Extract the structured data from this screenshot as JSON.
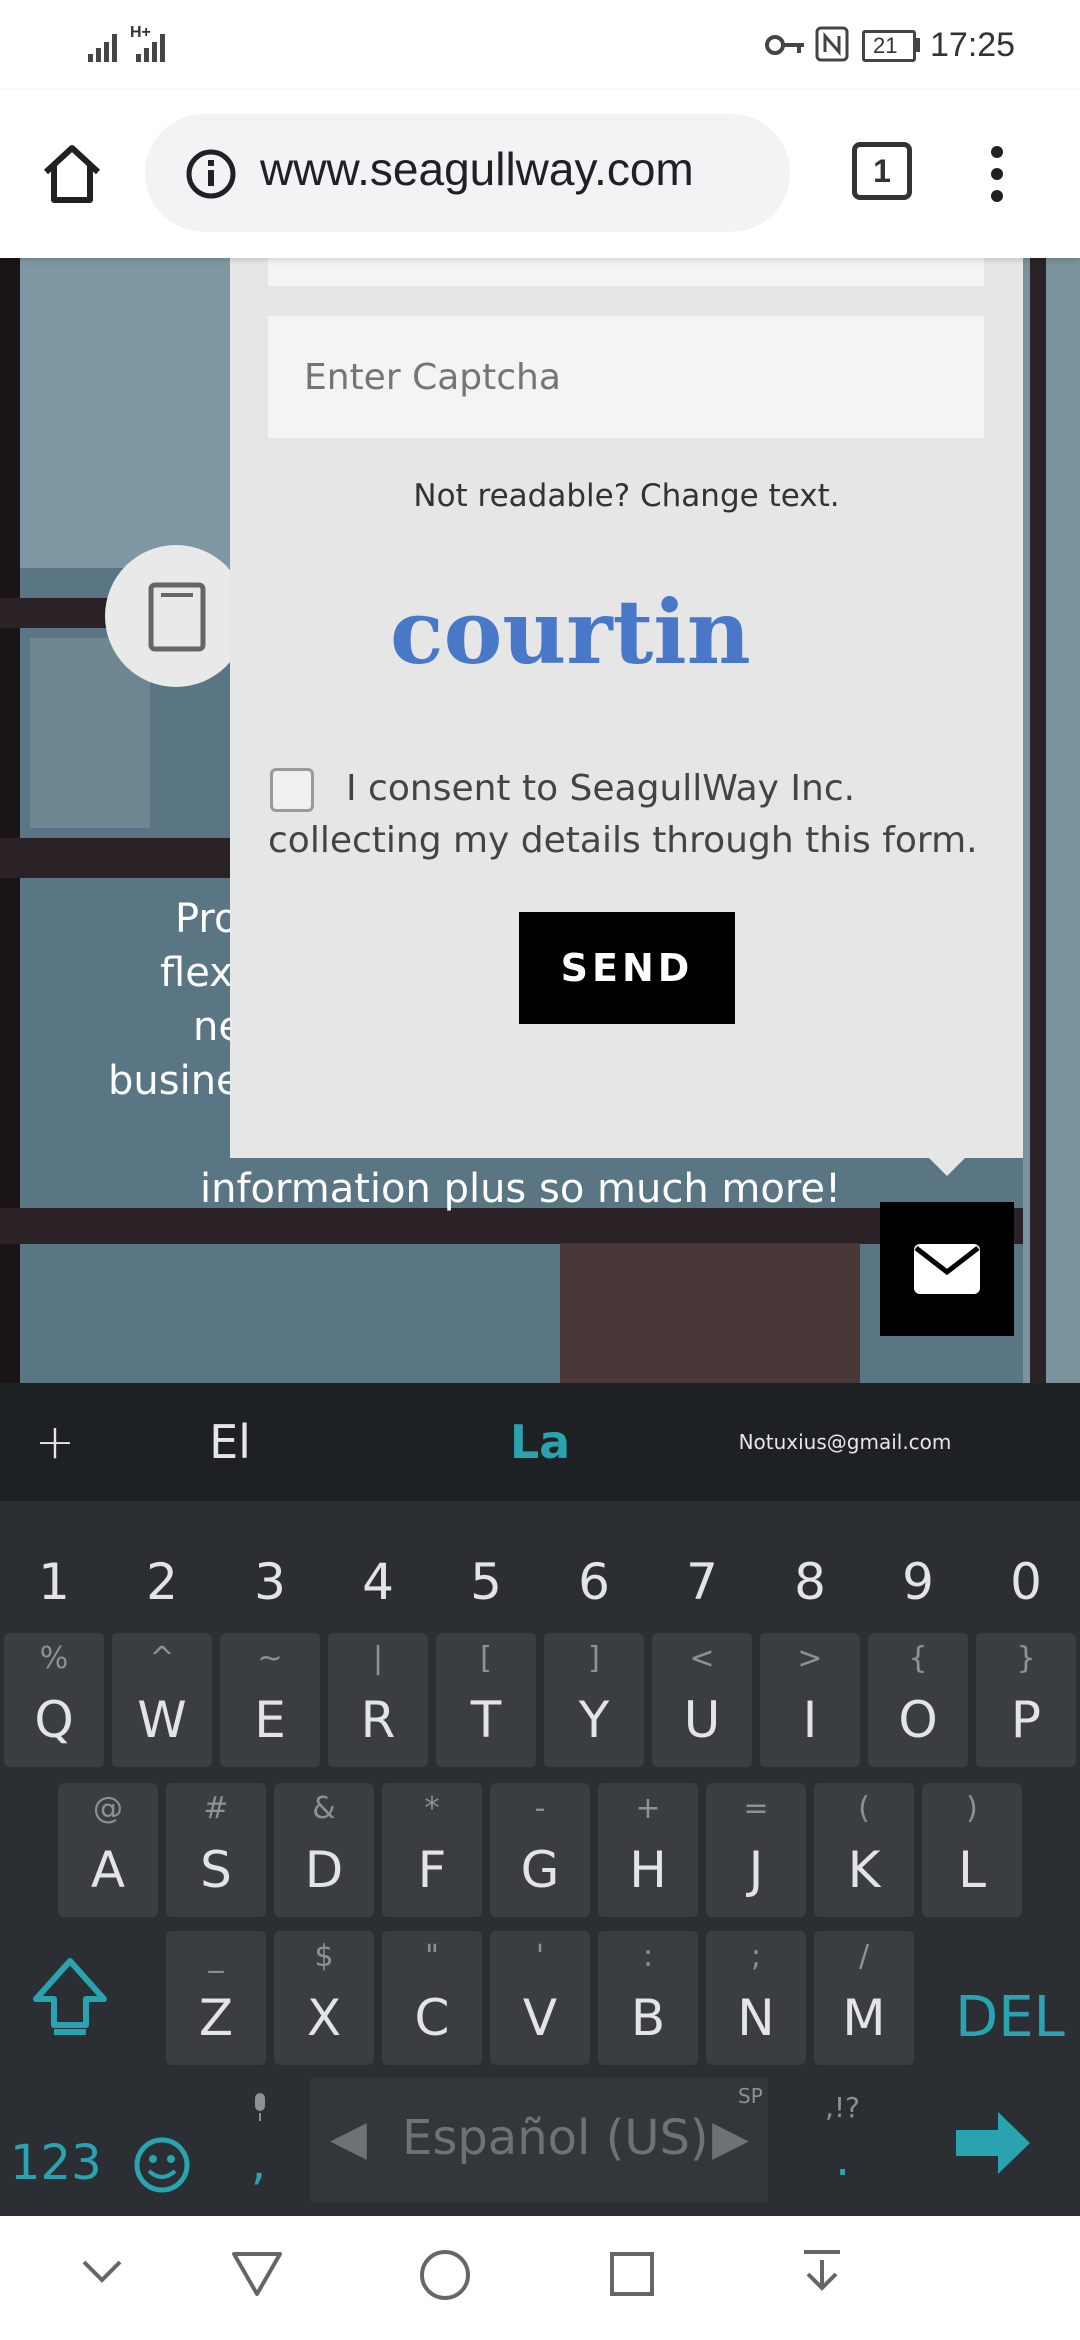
{
  "status_bar": {
    "time": "17:25",
    "battery": "21",
    "network": "H+"
  },
  "browser": {
    "url": "www.seagullway.com",
    "tab_count": "1"
  },
  "background": {
    "partial_lines": [
      "Pro",
      "flex",
      "ne",
      "busine"
    ],
    "visible_line": "information plus so much more!"
  },
  "form": {
    "captcha_placeholder": "Enter Captcha",
    "change_text": "Not readable? Change text.",
    "captcha_word": "courtin",
    "consent_line1": "I consent to SeagullWay Inc.",
    "consent_line2": "collecting my details through this form.",
    "send_label": "SEND"
  },
  "keyboard": {
    "suggestions": {
      "left": "El",
      "middle": "La",
      "right": "Notuxius@gmail.com"
    },
    "numbers": [
      "1",
      "2",
      "3",
      "4",
      "5",
      "6",
      "7",
      "8",
      "9",
      "0"
    ],
    "row1": [
      {
        "main": "Q",
        "alt": "%"
      },
      {
        "main": "W",
        "alt": "^"
      },
      {
        "main": "E",
        "alt": "~"
      },
      {
        "main": "R",
        "alt": "|"
      },
      {
        "main": "T",
        "alt": "["
      },
      {
        "main": "Y",
        "alt": "]"
      },
      {
        "main": "U",
        "alt": "<"
      },
      {
        "main": "I",
        "alt": ">"
      },
      {
        "main": "O",
        "alt": "{"
      },
      {
        "main": "P",
        "alt": "}"
      }
    ],
    "row2": [
      {
        "main": "A",
        "alt": "@"
      },
      {
        "main": "S",
        "alt": "#"
      },
      {
        "main": "D",
        "alt": "&"
      },
      {
        "main": "F",
        "alt": "*"
      },
      {
        "main": "G",
        "alt": "-"
      },
      {
        "main": "H",
        "alt": "+"
      },
      {
        "main": "J",
        "alt": "="
      },
      {
        "main": "K",
        "alt": "("
      },
      {
        "main": "L",
        "alt": ")"
      }
    ],
    "row3": [
      {
        "main": "Z",
        "alt": "_"
      },
      {
        "main": "X",
        "alt": "$"
      },
      {
        "main": "C",
        "alt": "\""
      },
      {
        "main": "V",
        "alt": "'"
      },
      {
        "main": "B",
        "alt": ":"
      },
      {
        "main": "N",
        "alt": ";"
      },
      {
        "main": "M",
        "alt": "/"
      }
    ],
    "del_label": "DEL",
    "num_toggle": "123",
    "comma": ",",
    "space_label": "Español (US)",
    "space_hint": "SP",
    "punct_hint": ",!?",
    "period": "."
  }
}
